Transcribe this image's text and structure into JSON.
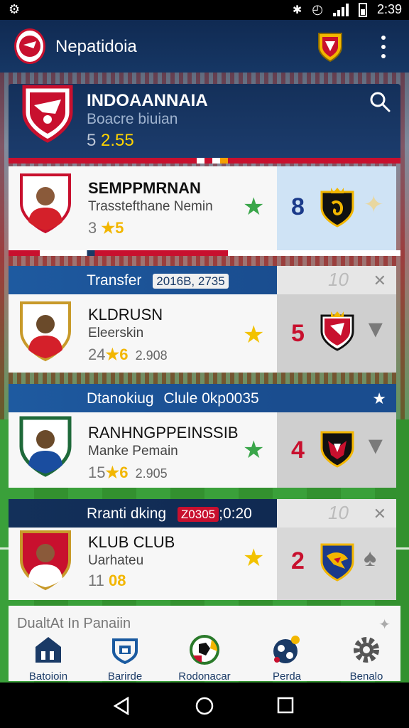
{
  "status_bar": {
    "left_icon": "settings-icon",
    "time": "2:39"
  },
  "app_bar": {
    "title": "Nepatidoia",
    "menu_icon": "more-vert-icon"
  },
  "hero": {
    "title": "INDOAANNAIA",
    "subtitle": "Boacre biuian",
    "score_prefix": "5",
    "score_value": "2.55",
    "search_icon": "search-icon"
  },
  "rows": [
    {
      "name": "SEMPPMRNAN",
      "sub": "Trasstefthane Nemin",
      "score_prefix": "3",
      "score_value": "5",
      "score_extra": "",
      "side_num": "8",
      "side_num_color": "#1a3a8a",
      "star_color": "#3aa64a",
      "side_icon": "star"
    },
    {
      "banner": "Transfer",
      "banner_tag": "2016B, 2735",
      "banner_ghost": "10",
      "name": "KLDRUSN",
      "sub": "Eleerskin",
      "score_prefix": "24",
      "score_value": "6",
      "score_extra": "2.908",
      "side_num": "5",
      "side_num_color": "#c8102e",
      "star_color": "#f2c200"
    },
    {
      "banner": "Dtanokiug",
      "banner_tag2": "Clule 0kp0035",
      "name": "RANHNGPPEINSSIB",
      "sub": "Manke Pemain",
      "score_prefix": "15",
      "score_value": "6",
      "score_extra": "2.905",
      "side_num": "4",
      "side_num_color": "#c8102e",
      "star_color": "#3aa64a"
    },
    {
      "banner": "Rranti dking",
      "banner_tag": "Z0305",
      "banner_tag_tail": ";0:20",
      "banner_ghost": "10",
      "name": "KLUB CLUB",
      "sub": "Uarhateu",
      "score_prefix": "11",
      "score_value": "08",
      "score_extra": "",
      "side_num": "2",
      "side_num_color": "#c8102e",
      "star_color": "#f2c200"
    }
  ],
  "bottom_nav": {
    "title": "DualtAt In Panaiin",
    "items": [
      {
        "label": "Batoioin",
        "icon": "home-icon"
      },
      {
        "label": "Barirde",
        "icon": "team-icon"
      },
      {
        "label": "Rodonacar",
        "icon": "ball-icon"
      },
      {
        "label": "Perda",
        "icon": "stats-icon"
      },
      {
        "label": "Benalo",
        "icon": "gear-icon"
      }
    ]
  },
  "colors": {
    "primary": "#163765",
    "accent_red": "#c8102e",
    "accent_yellow": "#f2c200"
  }
}
